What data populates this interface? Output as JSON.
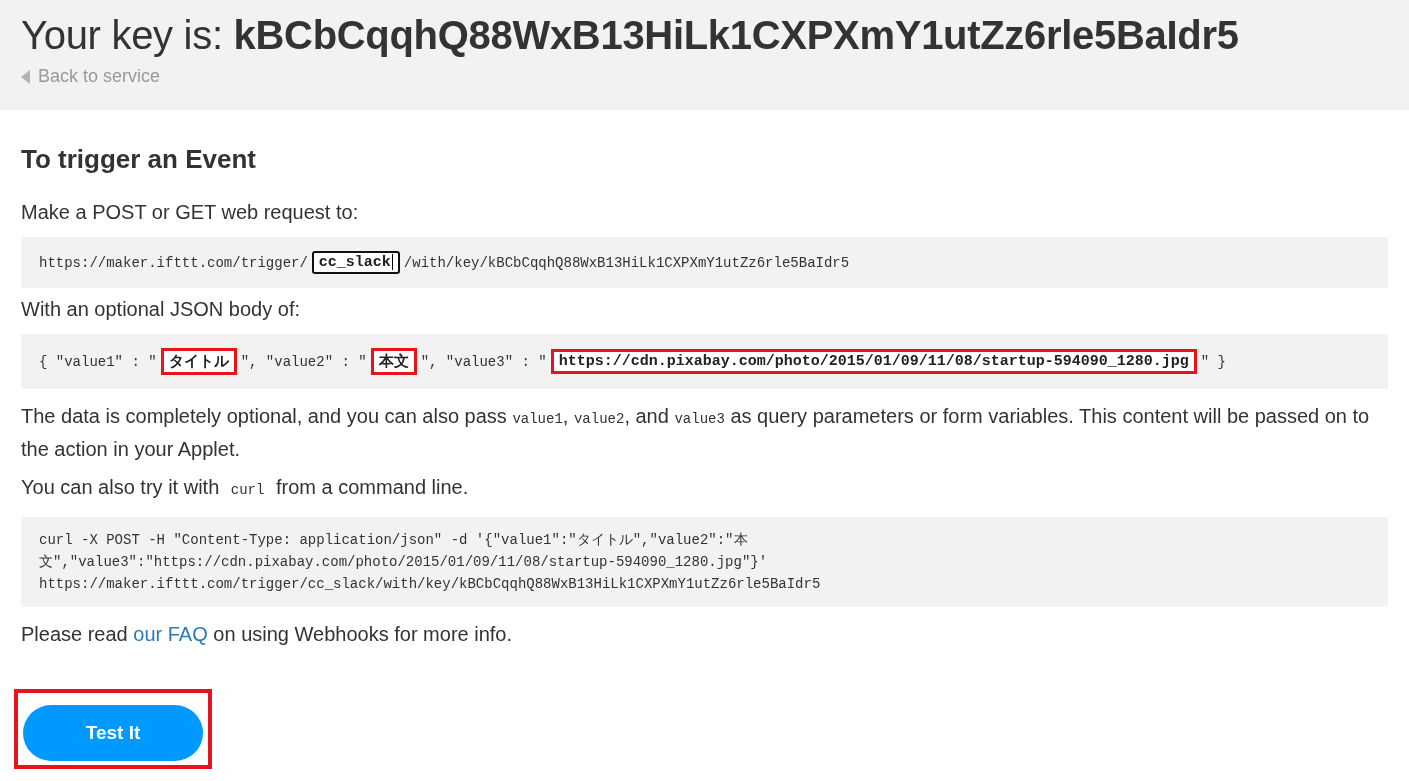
{
  "header": {
    "title_prefix": "Your key is: ",
    "key": "kBCbCqqhQ88WxB13HiLk1CXPXmY1utZz6rle5BaIdr5",
    "back_link": "Back to service"
  },
  "section_title": "To trigger an Event",
  "request_intro": "Make a POST or GET web request to:",
  "request_url": [
    {
      "kind": "text",
      "text": "https://maker.ifttt.com/trigger/"
    },
    {
      "kind": "field",
      "value": "cc_slack",
      "highlighted": false,
      "focused": true
    },
    {
      "kind": "text",
      "text": "/with/key/kBCbCqqhQ88WxB13HiLk1CXPXmY1utZz6rle5BaIdr5"
    }
  ],
  "body_intro": "With an optional JSON body of:",
  "json_body": [
    {
      "kind": "text",
      "text": "{ \"value1\" : \""
    },
    {
      "kind": "field",
      "value": "タイトル",
      "highlighted": true,
      "focused": false
    },
    {
      "kind": "text",
      "text": "\", \"value2\" : \""
    },
    {
      "kind": "field",
      "value": "本文",
      "highlighted": true,
      "focused": false
    },
    {
      "kind": "text",
      "text": "\", \"value3\" : \""
    },
    {
      "kind": "field",
      "value": "https://cdn.pixabay.com/photo/2015/01/09/11/08/startup-594090_1280.jpg",
      "highlighted": true,
      "focused": false
    },
    {
      "kind": "text",
      "text": "\" }"
    }
  ],
  "optional_note": [
    {
      "kind": "text",
      "text": "The data is completely optional, and you can also pass "
    },
    {
      "kind": "code",
      "text": "value1"
    },
    {
      "kind": "text",
      "text": ", "
    },
    {
      "kind": "code",
      "text": "value2"
    },
    {
      "kind": "text",
      "text": ", and "
    },
    {
      "kind": "code",
      "text": "value3"
    },
    {
      "kind": "text",
      "text": " as query parameters or form variables. This content will be passed on to the action in your Applet."
    }
  ],
  "curl_intro": [
    {
      "kind": "text",
      "text": "You can also try it with "
    },
    {
      "kind": "code",
      "text": "curl"
    },
    {
      "kind": "text",
      "text": " from a command line."
    }
  ],
  "curl_lines": [
    "curl -X POST -H \"Content-Type: application/json\" -d '{\"value1\":\"タイトル\",\"value2\":\"本",
    "文\",\"value3\":\"https://cdn.pixabay.com/photo/2015/01/09/11/08/startup-594090_1280.jpg\"}'",
    "https://maker.ifttt.com/trigger/cc_slack/with/key/kBCbCqqhQ88WxB13HiLk1CXPXmY1utZz6rle5BaIdr5"
  ],
  "faq": {
    "before": "Please read ",
    "link": "our FAQ",
    "after": " on using Webhooks for more info."
  },
  "test_button": {
    "label": "Test It",
    "highlighted": true
  }
}
